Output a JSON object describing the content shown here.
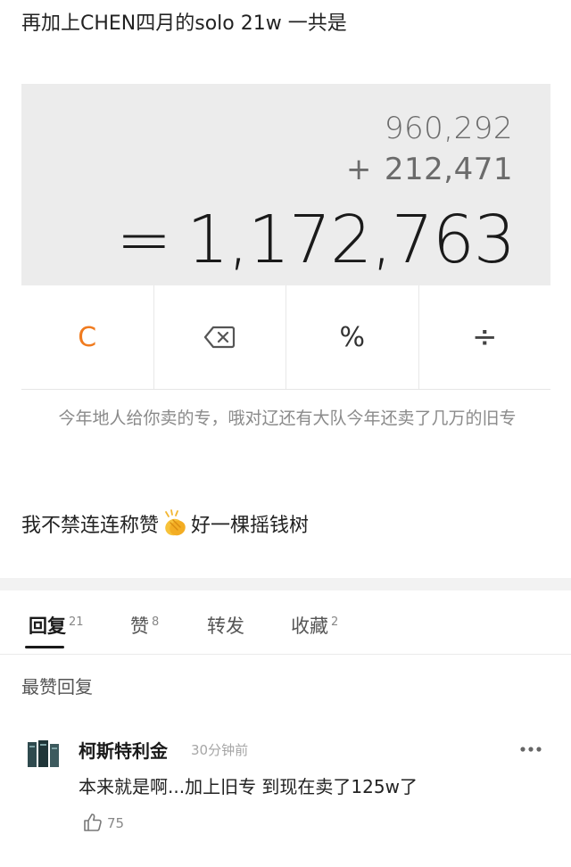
{
  "post": {
    "line1": "再加上CHEN四月的solo 21w 一共是",
    "line2_before": "我不禁连连称赞",
    "line2_after": "好一棵摇钱树",
    "emoji": "clapping-hands-icon"
  },
  "calculator": {
    "operand1": "960,292",
    "operator": "+",
    "operand2": "212,471",
    "equals": "=",
    "result": "1,172,763",
    "keys": [
      "C",
      "backspace-icon",
      "%",
      "÷"
    ],
    "accent": "#f07b1f"
  },
  "caption": {
    "text": "今年地人给你卖的专，哦对辽还有大队今年还卖了几万的旧专"
  },
  "tabs": [
    {
      "label": "回复",
      "count": "21"
    },
    {
      "label": "赞",
      "count": "8"
    },
    {
      "label": "转发",
      "count": ""
    },
    {
      "label": "收藏",
      "count": "2"
    }
  ],
  "section": {
    "title": "最赞回复"
  },
  "comment": {
    "author": "柯斯特利金",
    "time": "30分钟前",
    "body": "本来就是啊...加上旧专 到现在卖了125w了",
    "likes": "75"
  }
}
